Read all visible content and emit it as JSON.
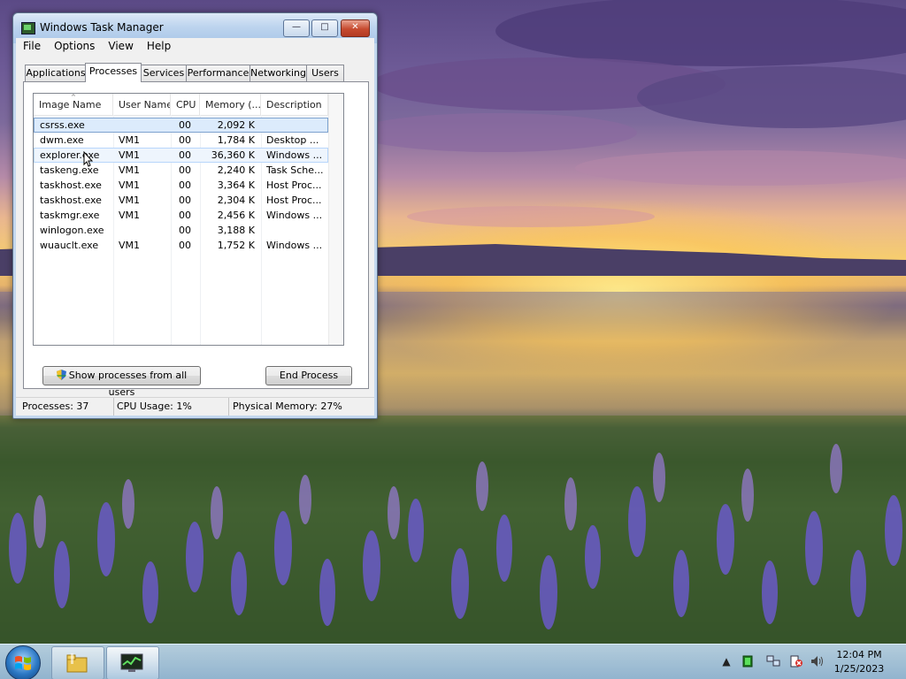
{
  "window": {
    "title": "Windows Task Manager",
    "controls": {
      "minimize": "—",
      "maximize": "□",
      "close": "✕"
    }
  },
  "menu": [
    "File",
    "Options",
    "View",
    "Help"
  ],
  "tabs": [
    "Applications",
    "Processes",
    "Services",
    "Performance",
    "Networking",
    "Users"
  ],
  "active_tab": "Processes",
  "table": {
    "columns": [
      "Image Name",
      "User Name",
      "CPU",
      "Memory (...",
      "Description"
    ],
    "rows": [
      {
        "name": "csrss.exe",
        "user": "",
        "cpu": "00",
        "mem": "2,092 K",
        "desc": ""
      },
      {
        "name": "dwm.exe",
        "user": "VM1",
        "cpu": "00",
        "mem": "1,784 K",
        "desc": "Desktop ..."
      },
      {
        "name": "explorer.exe",
        "user": "VM1",
        "cpu": "00",
        "mem": "36,360 K",
        "desc": "Windows ..."
      },
      {
        "name": "taskeng.exe",
        "user": "VM1",
        "cpu": "00",
        "mem": "2,240 K",
        "desc": "Task Sche..."
      },
      {
        "name": "taskhost.exe",
        "user": "VM1",
        "cpu": "00",
        "mem": "3,364 K",
        "desc": "Host Proc..."
      },
      {
        "name": "taskhost.exe",
        "user": "VM1",
        "cpu": "00",
        "mem": "2,304 K",
        "desc": "Host Proc..."
      },
      {
        "name": "taskmgr.exe",
        "user": "VM1",
        "cpu": "00",
        "mem": "2,456 K",
        "desc": "Windows ..."
      },
      {
        "name": "winlogon.exe",
        "user": "",
        "cpu": "00",
        "mem": "3,188 K",
        "desc": ""
      },
      {
        "name": "wuauclt.exe",
        "user": "VM1",
        "cpu": "00",
        "mem": "1,752 K",
        "desc": "Windows ..."
      }
    ]
  },
  "buttons": {
    "show_all": "Show processes from all users",
    "end_process": "End Process"
  },
  "status": {
    "processes": "Processes: 37",
    "cpu": "CPU Usage: 1%",
    "memory": "Physical Memory: 27%"
  },
  "taskbar": {
    "time": "12:04 PM",
    "date": "1/25/2023",
    "tray_icons": [
      "show-hidden-icons",
      "task-manager-tray-icon",
      "network-icon",
      "action-center-icon",
      "volume-icon"
    ]
  },
  "colors": {
    "selection": "#dcebfc",
    "close_button": "#c64a2f",
    "taskbar": "#a9c6e3"
  }
}
